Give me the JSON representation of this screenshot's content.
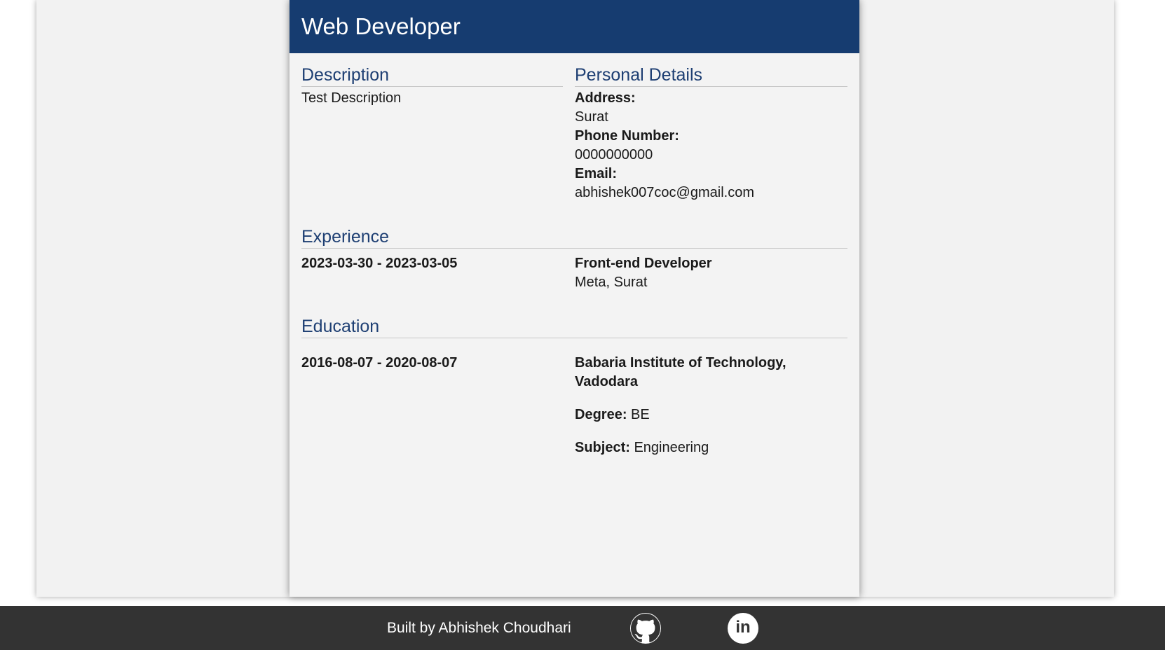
{
  "resume": {
    "title": "Web Developer",
    "description": {
      "heading": "Description",
      "text": "Test Description"
    },
    "personal_details": {
      "heading": "Personal Details",
      "address_label": "Address:",
      "address": "Surat",
      "phone_label": "Phone Number:",
      "phone": "0000000000",
      "email_label": "Email:",
      "email": "abhishek007coc@gmail.com"
    },
    "experience": {
      "heading": "Experience",
      "items": [
        {
          "dates": "2023-03-30 - 2023-03-05",
          "role": "Front-end Developer",
          "company": "Meta, Surat"
        }
      ]
    },
    "education": {
      "heading": "Education",
      "items": [
        {
          "dates": "2016-08-07 - 2020-08-07",
          "institution": "Babaria Institute of Technology, Vadodara",
          "degree_label": "Degree:",
          "degree": "BE",
          "subject_label": "Subject:",
          "subject": "Engineering"
        }
      ]
    }
  },
  "footer": {
    "credit": "Built by Abhishek Choudhari",
    "github_icon": "github-icon",
    "linkedin_icon": "linkedin-icon",
    "linkedin_glyph": "in"
  },
  "colors": {
    "header_bg": "#163c70",
    "heading_text": "#1e3f73",
    "footer_bg": "#333333"
  }
}
